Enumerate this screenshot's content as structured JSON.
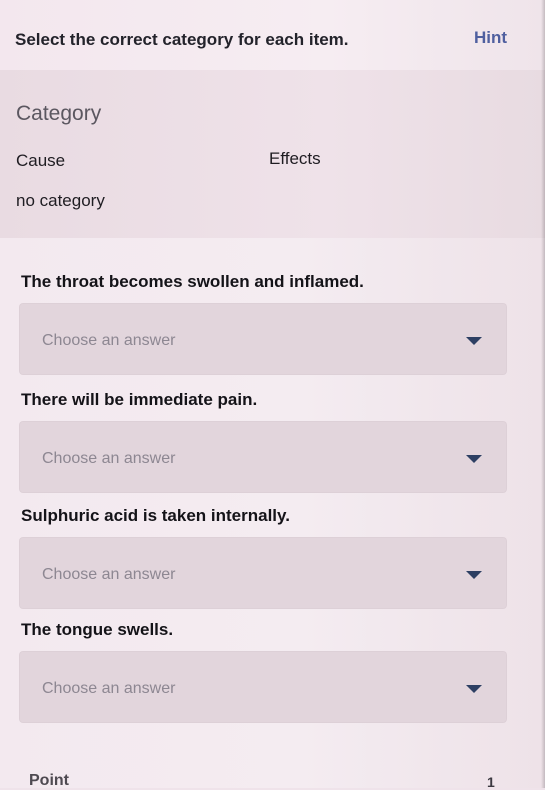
{
  "header": {
    "title": "Select the correct category for each item.",
    "hint_label": "Hint"
  },
  "categories": {
    "heading": "Category",
    "items": [
      "Cause",
      "Effects",
      "no category"
    ]
  },
  "questions": [
    {
      "text": "The throat becomes swollen and inflamed.",
      "placeholder": "Choose an answer"
    },
    {
      "text": "There will be immediate pain.",
      "placeholder": "Choose an answer"
    },
    {
      "text": "Sulphuric acid is taken internally.",
      "placeholder": "Choose an answer"
    },
    {
      "text": "The tongue swells.",
      "placeholder": "Choose an answer"
    }
  ],
  "footer": {
    "label": "Point",
    "value": "1"
  },
  "colors": {
    "hint": "#4f5f9f",
    "panel": "#e9dbe2",
    "dropdown": "#e2d5dc",
    "icon": "#2d3f63"
  },
  "icons": {
    "dropdown": "chevron-down-icon"
  }
}
